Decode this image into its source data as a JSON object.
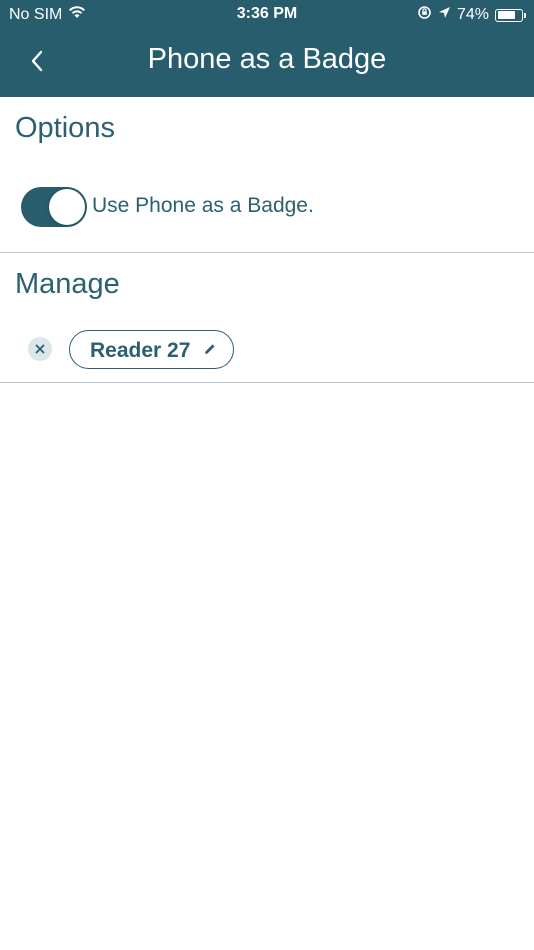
{
  "status_bar": {
    "carrier": "No SIM",
    "time": "3:36 PM",
    "battery_percent": "74%",
    "battery_level": 0.74
  },
  "header": {
    "title": "Phone as a Badge",
    "back_icon": "chevron-left-icon"
  },
  "options": {
    "title": "Options",
    "toggle_label": "Use Phone as a Badge.",
    "toggle_on": true
  },
  "manage": {
    "title": "Manage",
    "readers": [
      {
        "name": "Reader 27"
      }
    ]
  },
  "colors": {
    "primary": "#275d6c",
    "text": "#2a6070",
    "divider": "#b9ccd2",
    "remove_bg": "#dbe6ea",
    "background": "#ffffff"
  }
}
